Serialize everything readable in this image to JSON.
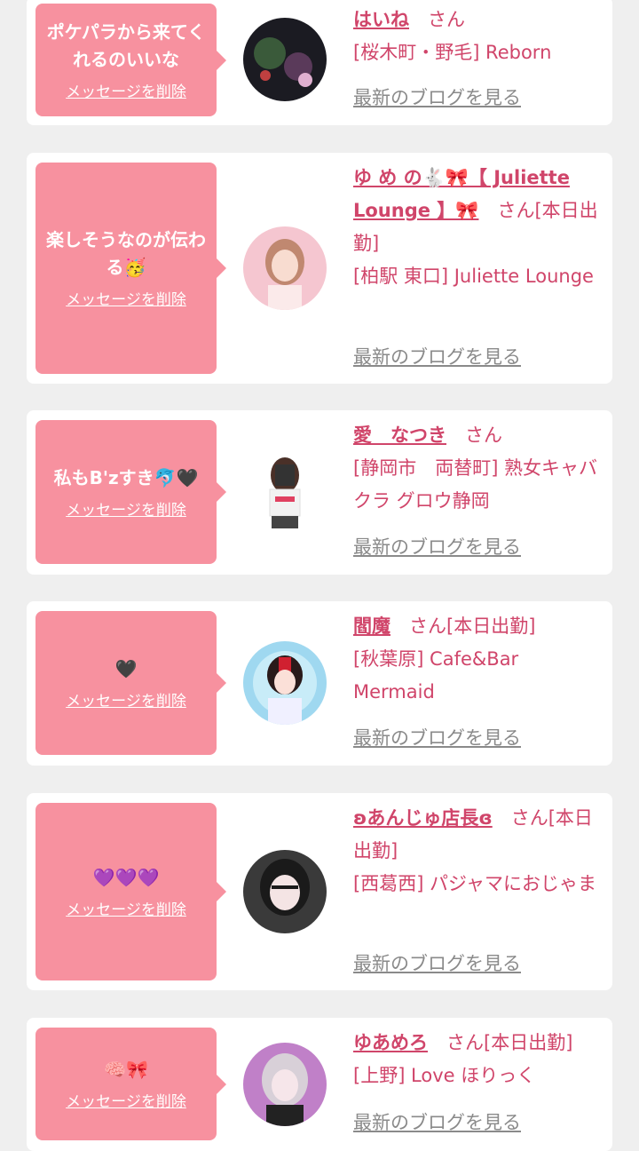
{
  "cards": [
    {
      "message": "ポケパラから来てくれるのいいな",
      "delete_label": "メッセージを削除",
      "name": "はいね",
      "san": "さん",
      "shop": "[桜木町・野毛] Reborn",
      "blog_label": "最新のブログを見る"
    },
    {
      "message": "楽しそうなのが伝わる🥳",
      "delete_label": "メッセージを削除",
      "name": "ゆ め の🐇🎀【 Juliette Lounge 】🎀",
      "san": "さん[本日出勤]",
      "shop": "[柏駅 東口] Juliette Lounge",
      "blog_label": "最新のブログを見る"
    },
    {
      "message": "私もB'zすき🐬🖤",
      "delete_label": "メッセージを削除",
      "name": "愛　なつき",
      "san": "さん",
      "shop": "[静岡市　両替町] 熟女キャバクラ グロウ静岡",
      "blog_label": "最新のブログを見る"
    },
    {
      "message": "🖤",
      "delete_label": "メッセージを削除",
      "name": "閻魔",
      "san": "さん[本日出勤]",
      "shop": "[秋葉原] Cafe&Bar Mermaid",
      "blog_label": "最新のブログを見る"
    },
    {
      "message": "💜💜💜",
      "delete_label": "メッセージを削除",
      "name": "ʚあんじゅ店長ɞ",
      "san": "さん[本日出勤]",
      "shop": "[西葛西] パジャマにおじゃま",
      "blog_label": "最新のブログを見る"
    },
    {
      "message": "🧠🎀",
      "delete_label": "メッセージを削除",
      "name": "ゆあめろ",
      "san": "さん[本日出勤]",
      "shop": "[上野] Love ほりっく",
      "blog_label": "最新のブログを見る"
    }
  ],
  "colors": {
    "bubble": "#f7919f",
    "accent_text": "#d0456a",
    "link_gray": "#8a8a8a",
    "page_bg": "#efefef"
  }
}
